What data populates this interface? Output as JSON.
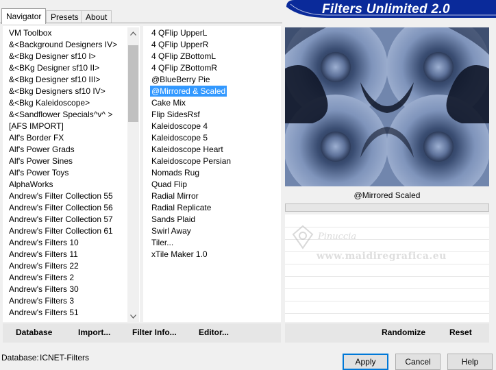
{
  "tabs": [
    "Navigator",
    "Presets",
    "About"
  ],
  "banner": {
    "title": "Filters Unlimited 2.0"
  },
  "categories": [
    "VM Toolbox",
    "&<Background Designers IV>",
    "&<Bkg Designer sf10 I>",
    "&<BKg Designer sf10 II>",
    "&<Bkg Designer sf10 III>",
    "&<Bkg Designers sf10 IV>",
    "&<Bkg Kaleidoscope>",
    "&<Sandflower Specials^v^ >",
    "[AFS IMPORT]",
    "Alf's Border FX",
    "Alf's Power Grads",
    "Alf's Power Sines",
    "Alf's Power Toys",
    "AlphaWorks",
    "Andrew's Filter Collection 55",
    "Andrew's Filter Collection 56",
    "Andrew's Filter Collection 57",
    "Andrew's Filter Collection 61",
    "Andrew's Filters 10",
    "Andrew's Filters 11",
    "Andrew's Filters 22",
    "Andrew's Filters 2",
    "Andrew's Filters 30",
    "Andrew's Filters 3",
    "Andrew's Filters 51"
  ],
  "filters": [
    "4 QFlip UpperL",
    "4 QFlip UpperR",
    "4 QFlip ZBottomL",
    "4 QFlip ZBottomR",
    "@BlueBerry Pie",
    "@Mirrored & Scaled",
    "Cake Mix",
    "Flip SidesRsf",
    "Kaleidoscope 4",
    "Kaleidoscope 5",
    "Kaleidoscope Heart",
    "Kaleidoscope Persian",
    "Nomads Rug",
    "Quad Flip",
    "Radial Mirror",
    "Radial Replicate",
    "Sands Plaid",
    "Swirl Away",
    "Tiler...",
    "xTile Maker 1.0"
  ],
  "selected_filter_index": 5,
  "preview": {
    "label": "@Mirrored  Scaled"
  },
  "watermark": {
    "name": "Pinuccia",
    "url": "www.maidiregrafica.eu"
  },
  "left_buttons": [
    "Database",
    "Import...",
    "Filter Info...",
    "Editor..."
  ],
  "right_buttons": [
    "Randomize",
    "Reset"
  ],
  "status": {
    "database_label": "Database:",
    "database_value": "ICNET-Filters"
  },
  "dialog_buttons": [
    "Apply",
    "Cancel",
    "Help"
  ],
  "icons": {
    "scroll_up": "chevron-up-icon",
    "scroll_down": "chevron-down-icon"
  },
  "colors": {
    "banner": "#0a2a9a",
    "selection": "#3399ff",
    "preview_base": "#6b80a6"
  }
}
